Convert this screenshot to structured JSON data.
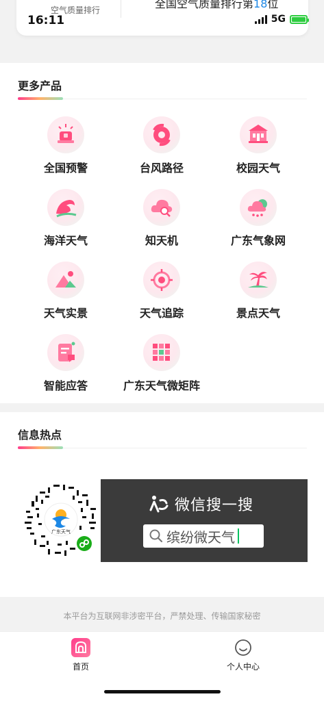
{
  "status_bar": {
    "time": "16:11",
    "network": "5G"
  },
  "air_quality": {
    "label": "空气质量排行",
    "rank_prefix": "全国空气质量排行第",
    "rank_number": "18",
    "rank_suffix": "位"
  },
  "more_products": {
    "title": "更多产品",
    "items": [
      {
        "label": "全国预警",
        "icon": "alarm-light-icon"
      },
      {
        "label": "台风路径",
        "icon": "typhoon-icon"
      },
      {
        "label": "校园天气",
        "icon": "school-building-icon"
      },
      {
        "label": "海洋天气",
        "icon": "ocean-wave-icon"
      },
      {
        "label": "知天机",
        "icon": "cloud-search-icon"
      },
      {
        "label": "广东气象网",
        "icon": "cloud-rain-icon"
      },
      {
        "label": "天气实景",
        "icon": "mountain-sun-icon"
      },
      {
        "label": "天气追踪",
        "icon": "target-crosshair-icon"
      },
      {
        "label": "景点天气",
        "icon": "palm-island-icon"
      },
      {
        "label": "智能应答",
        "icon": "chat-document-icon"
      },
      {
        "label": "广东天气微矩阵",
        "icon": "grid-matrix-icon"
      }
    ]
  },
  "info_hotspot": {
    "title": "信息热点",
    "qr_caption": "广东天气",
    "wechat_search_label": "微信搜一搜",
    "search_term": "缤纷微天气"
  },
  "footer_note": "本平台为互联网非涉密平台，严禁处理、传输国家秘密",
  "tabbar": {
    "home": "首页",
    "me": "个人中心"
  },
  "colors": {
    "accent_pink": "#ff3d8b",
    "accent_green": "#9be0b8",
    "rank_number": "#1e88e5",
    "banner_bg": "#3b3b3b"
  }
}
